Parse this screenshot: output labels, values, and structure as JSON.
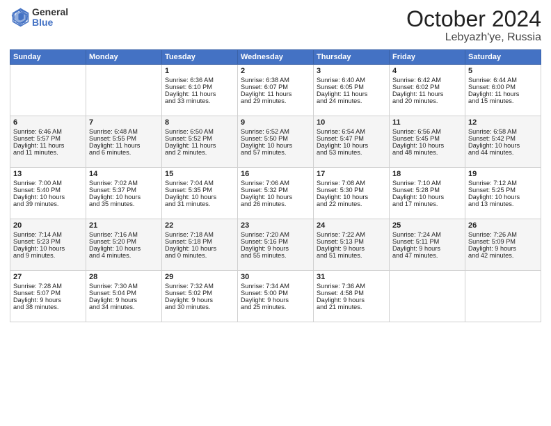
{
  "logo": {
    "general": "General",
    "blue": "Blue"
  },
  "header": {
    "month": "October 2024",
    "location": "Lebyazh'ye, Russia"
  },
  "days_header": [
    "Sunday",
    "Monday",
    "Tuesday",
    "Wednesday",
    "Thursday",
    "Friday",
    "Saturday"
  ],
  "weeks": [
    [
      {
        "day": "",
        "info": ""
      },
      {
        "day": "",
        "info": ""
      },
      {
        "day": "1",
        "info": "Sunrise: 6:36 AM\nSunset: 6:10 PM\nDaylight: 11 hours\nand 33 minutes."
      },
      {
        "day": "2",
        "info": "Sunrise: 6:38 AM\nSunset: 6:07 PM\nDaylight: 11 hours\nand 29 minutes."
      },
      {
        "day": "3",
        "info": "Sunrise: 6:40 AM\nSunset: 6:05 PM\nDaylight: 11 hours\nand 24 minutes."
      },
      {
        "day": "4",
        "info": "Sunrise: 6:42 AM\nSunset: 6:02 PM\nDaylight: 11 hours\nand 20 minutes."
      },
      {
        "day": "5",
        "info": "Sunrise: 6:44 AM\nSunset: 6:00 PM\nDaylight: 11 hours\nand 15 minutes."
      }
    ],
    [
      {
        "day": "6",
        "info": "Sunrise: 6:46 AM\nSunset: 5:57 PM\nDaylight: 11 hours\nand 11 minutes."
      },
      {
        "day": "7",
        "info": "Sunrise: 6:48 AM\nSunset: 5:55 PM\nDaylight: 11 hours\nand 6 minutes."
      },
      {
        "day": "8",
        "info": "Sunrise: 6:50 AM\nSunset: 5:52 PM\nDaylight: 11 hours\nand 2 minutes."
      },
      {
        "day": "9",
        "info": "Sunrise: 6:52 AM\nSunset: 5:50 PM\nDaylight: 10 hours\nand 57 minutes."
      },
      {
        "day": "10",
        "info": "Sunrise: 6:54 AM\nSunset: 5:47 PM\nDaylight: 10 hours\nand 53 minutes."
      },
      {
        "day": "11",
        "info": "Sunrise: 6:56 AM\nSunset: 5:45 PM\nDaylight: 10 hours\nand 48 minutes."
      },
      {
        "day": "12",
        "info": "Sunrise: 6:58 AM\nSunset: 5:42 PM\nDaylight: 10 hours\nand 44 minutes."
      }
    ],
    [
      {
        "day": "13",
        "info": "Sunrise: 7:00 AM\nSunset: 5:40 PM\nDaylight: 10 hours\nand 39 minutes."
      },
      {
        "day": "14",
        "info": "Sunrise: 7:02 AM\nSunset: 5:37 PM\nDaylight: 10 hours\nand 35 minutes."
      },
      {
        "day": "15",
        "info": "Sunrise: 7:04 AM\nSunset: 5:35 PM\nDaylight: 10 hours\nand 31 minutes."
      },
      {
        "day": "16",
        "info": "Sunrise: 7:06 AM\nSunset: 5:32 PM\nDaylight: 10 hours\nand 26 minutes."
      },
      {
        "day": "17",
        "info": "Sunrise: 7:08 AM\nSunset: 5:30 PM\nDaylight: 10 hours\nand 22 minutes."
      },
      {
        "day": "18",
        "info": "Sunrise: 7:10 AM\nSunset: 5:28 PM\nDaylight: 10 hours\nand 17 minutes."
      },
      {
        "day": "19",
        "info": "Sunrise: 7:12 AM\nSunset: 5:25 PM\nDaylight: 10 hours\nand 13 minutes."
      }
    ],
    [
      {
        "day": "20",
        "info": "Sunrise: 7:14 AM\nSunset: 5:23 PM\nDaylight: 10 hours\nand 9 minutes."
      },
      {
        "day": "21",
        "info": "Sunrise: 7:16 AM\nSunset: 5:20 PM\nDaylight: 10 hours\nand 4 minutes."
      },
      {
        "day": "22",
        "info": "Sunrise: 7:18 AM\nSunset: 5:18 PM\nDaylight: 10 hours\nand 0 minutes."
      },
      {
        "day": "23",
        "info": "Sunrise: 7:20 AM\nSunset: 5:16 PM\nDaylight: 9 hours\nand 55 minutes."
      },
      {
        "day": "24",
        "info": "Sunrise: 7:22 AM\nSunset: 5:13 PM\nDaylight: 9 hours\nand 51 minutes."
      },
      {
        "day": "25",
        "info": "Sunrise: 7:24 AM\nSunset: 5:11 PM\nDaylight: 9 hours\nand 47 minutes."
      },
      {
        "day": "26",
        "info": "Sunrise: 7:26 AM\nSunset: 5:09 PM\nDaylight: 9 hours\nand 42 minutes."
      }
    ],
    [
      {
        "day": "27",
        "info": "Sunrise: 7:28 AM\nSunset: 5:07 PM\nDaylight: 9 hours\nand 38 minutes."
      },
      {
        "day": "28",
        "info": "Sunrise: 7:30 AM\nSunset: 5:04 PM\nDaylight: 9 hours\nand 34 minutes."
      },
      {
        "day": "29",
        "info": "Sunrise: 7:32 AM\nSunset: 5:02 PM\nDaylight: 9 hours\nand 30 minutes."
      },
      {
        "day": "30",
        "info": "Sunrise: 7:34 AM\nSunset: 5:00 PM\nDaylight: 9 hours\nand 25 minutes."
      },
      {
        "day": "31",
        "info": "Sunrise: 7:36 AM\nSunset: 4:58 PM\nDaylight: 9 hours\nand 21 minutes."
      },
      {
        "day": "",
        "info": ""
      },
      {
        "day": "",
        "info": ""
      }
    ]
  ]
}
